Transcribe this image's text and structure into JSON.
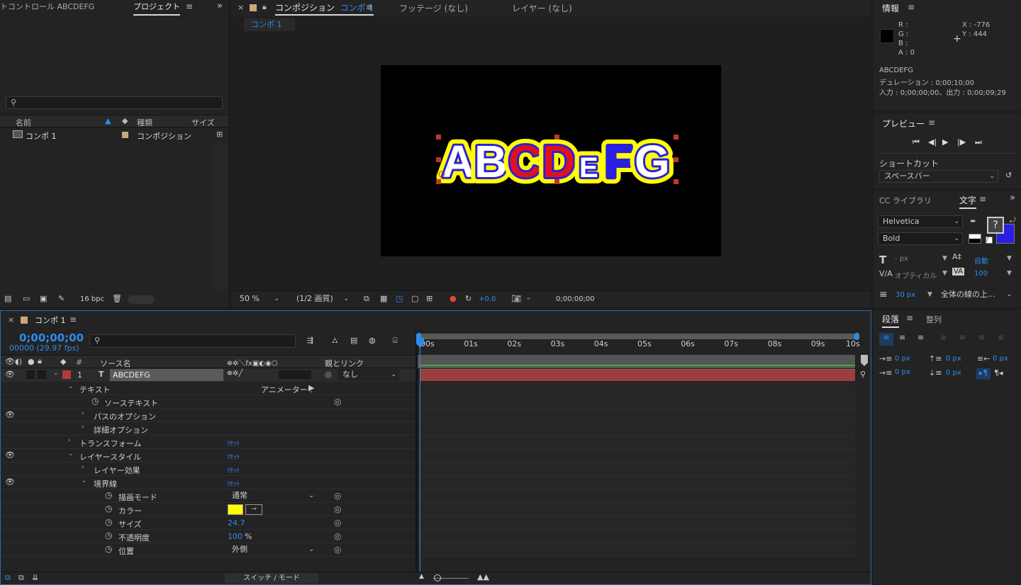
{
  "project_panel": {
    "tab_effects": "トコントロール ABCDEFG",
    "tab_project": "プロジェクト",
    "columns": {
      "name": "名前",
      "type": "種類",
      "size": "サイズ"
    },
    "items": [
      {
        "name": "コンポ 1",
        "type": "コンポジション"
      }
    ],
    "bpc": "16 bpc"
  },
  "comp_panel": {
    "tab_comp": "コンポジション",
    "tab_comp_name": "コンポ 1",
    "tab_footage": "フッテージ (なし)",
    "tab_layer": "レイヤー (なし)",
    "subtab": "コンポ 1",
    "zoom": "50 %",
    "resolution": "(1/2 画質)",
    "exposure": "+0.0",
    "timecode": "0;00;00;00",
    "text_letters": [
      {
        "ch": "A",
        "color": "#ffffff"
      },
      {
        "ch": "B",
        "color": "#ffffff"
      },
      {
        "ch": "C",
        "color": "#e0101e"
      },
      {
        "ch": "D",
        "color": "#e0101e"
      },
      {
        "ch": "E",
        "color": "#ffffff"
      },
      {
        "ch": "F",
        "color": "#2a1fe0"
      },
      {
        "ch": "G",
        "color": "#ffffff"
      }
    ],
    "stroke_color": "#ffff00",
    "inner_stroke_color": "#2a1fe0"
  },
  "info_panel": {
    "title": "情報",
    "r": "R :",
    "g": "G :",
    "b": "B :",
    "a": "A : 0",
    "x": "X : -776",
    "y": "Y : 444",
    "layer_name": "ABCDEFG",
    "duration": "デュレーション : 0;00;10;00",
    "in_out": "入力 : 0;00;00;00、出力 : 0;00;09;29"
  },
  "preview_panel": {
    "title": "プレビュー",
    "shortcut_label": "ショートカット",
    "shortcut_value": "スペースバー"
  },
  "character_panel": {
    "tab_cc": "CC ライブラリ",
    "tab_char": "文字",
    "font": "Helvetica",
    "style": "Bold",
    "size": "- px",
    "leading": "自動",
    "kerning": "オプティカル",
    "tracking": "100",
    "stroke_width": "30 px",
    "stroke_mode": "全体の線の上..."
  },
  "paragraph_panel": {
    "tab_para": "段落",
    "tab_align": "整列",
    "indent_left": "0 px",
    "indent_first": "0 px",
    "indent_right": "0 px",
    "space_before": "0 px",
    "space_after": "0 px"
  },
  "timeline": {
    "tab_name": "コンポ 1",
    "timecode": "0;00;00;00",
    "frames": "00000 (29.97 fps)",
    "col_source": "ソース名",
    "col_parent": "親とリンク",
    "ruler": [
      "00s",
      "01s",
      "02s",
      "03s",
      "04s",
      "05s",
      "06s",
      "07s",
      "08s",
      "09s",
      "10s"
    ],
    "layer": {
      "num": "1",
      "name": "ABCDEFG",
      "parent": "なし"
    },
    "props": {
      "text": "テキスト",
      "animator": "アニメーター :",
      "source_text": "ソーステキスト",
      "path_options": "パスのオプション",
      "more_options": "詳細オプション",
      "transform": "トランスフォーム",
      "layer_styles": "レイヤースタイル",
      "blending": "レイヤー効果",
      "stroke": "境界線",
      "blend_mode": "描画モード",
      "blend_mode_value": "通常",
      "color": "カラー",
      "size": "サイズ",
      "size_value": "24.7",
      "opacity": "不透明度",
      "opacity_value": "100",
      "opacity_unit": "%",
      "position": "位置",
      "position_value": "外側",
      "reset": "ﾘｾｯﾄ"
    },
    "footer": "スイッチ / モード"
  },
  "colors": {
    "accent": "#2d8ceb",
    "stroke_swatch": "#ffff00",
    "layer_label": "#b33a3a",
    "bar": "#9a3e3e"
  }
}
